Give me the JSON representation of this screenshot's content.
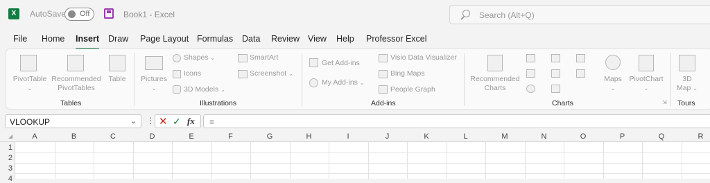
{
  "titlebar": {
    "autosave_label": "AutoSave",
    "autosave_state": "Off",
    "doc_title": "Book1  -  Excel",
    "search_placeholder": "Search (Alt+Q)"
  },
  "menu": [
    "File",
    "Home",
    "Insert",
    "Draw",
    "Page Layout",
    "Formulas",
    "Data",
    "Review",
    "View",
    "Help",
    "Professor Excel"
  ],
  "active_menu": "Insert",
  "ribbon": {
    "tables": {
      "label": "Tables",
      "pivottable": "PivotTable",
      "recommended_pivot_1": "Recommended",
      "recommended_pivot_2": "PivotTables",
      "table": "Table"
    },
    "illustrations": {
      "label": "Illustrations",
      "pictures": "Pictures",
      "shapes": "Shapes",
      "icons": "Icons",
      "models_3d": "3D Models",
      "smartart": "SmartArt",
      "screenshot": "Screenshot"
    },
    "addins": {
      "label": "Add-ins",
      "get_addins": "Get Add-ins",
      "my_addins": "My Add-ins",
      "visio": "Visio Data Visualizer",
      "bing_maps": "Bing Maps",
      "people_graph": "People Graph"
    },
    "charts": {
      "label": "Charts",
      "recommended_1": "Recommended",
      "recommended_2": "Charts",
      "maps": "Maps",
      "pivotchart": "PivotChart"
    },
    "tours": {
      "label": "Tours",
      "map_1": "3D",
      "map_2": "Map"
    }
  },
  "formula_bar": {
    "name_box": "VLOOKUP",
    "formula": "=",
    "fx": "fx"
  },
  "sheet": {
    "columns": [
      "A",
      "B",
      "C",
      "D",
      "E",
      "F",
      "G",
      "H",
      "I",
      "J",
      "K",
      "L",
      "M",
      "N",
      "O",
      "P",
      "Q",
      "R"
    ],
    "rows": [
      "1",
      "2",
      "3",
      "4"
    ]
  }
}
